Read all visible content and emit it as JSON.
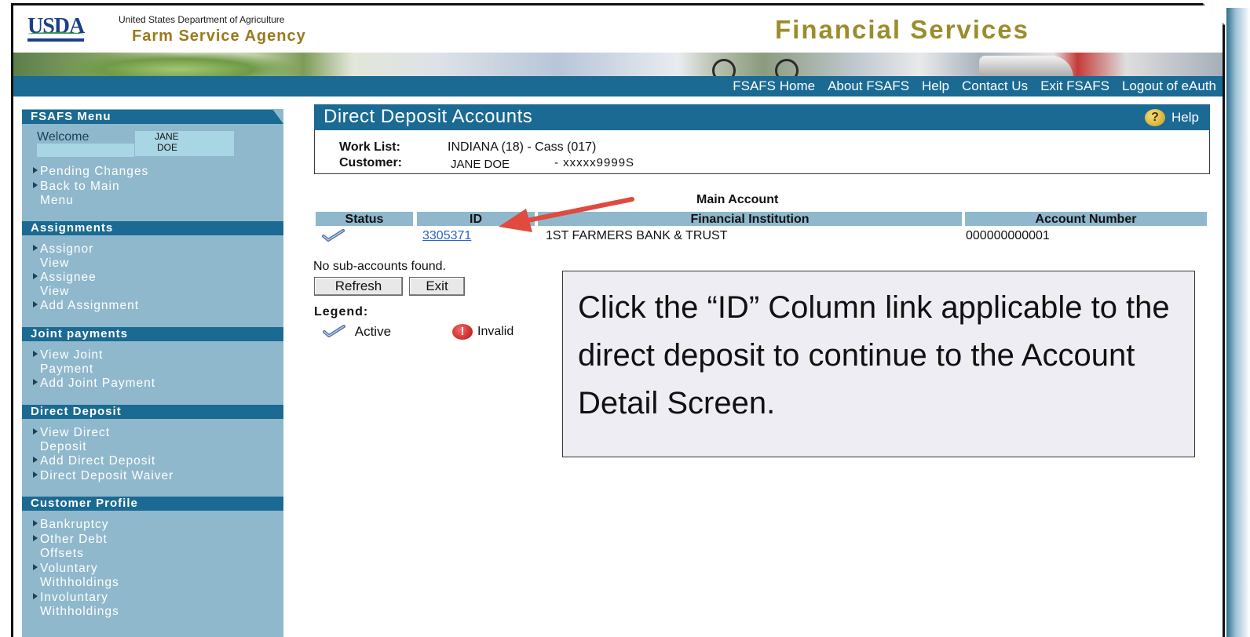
{
  "header": {
    "logo_text": "USDA",
    "department": "United States Department of Agriculture",
    "agency": "Farm Service Agency",
    "app_title": "Financial Services"
  },
  "topnav": {
    "items": [
      "FSAFS Home",
      "About FSAFS",
      "Help",
      "Contact Us",
      "Exit FSAFS",
      "Logout of eAuth"
    ]
  },
  "sidebar": {
    "menu_title": "FSAFS Menu",
    "welcome_label": "Welcome",
    "user_first": "JANE",
    "user_last": "DOE",
    "menu_items": [
      {
        "l1": "Pending Changes",
        "l2": ""
      },
      {
        "l1": "Back to Main",
        "l2": "Menu"
      }
    ],
    "assignments": {
      "title": "Assignments",
      "items": [
        {
          "l1": "Assignor",
          "l2": "View"
        },
        {
          "l1": "Assignee",
          "l2": "View"
        },
        {
          "l1": "Add Assignment",
          "l2": ""
        }
      ]
    },
    "joint_payments": {
      "title": "Joint payments",
      "items": [
        {
          "l1": "View Joint",
          "l2": "Payment"
        },
        {
          "l1": "Add Joint Payment",
          "l2": ""
        }
      ]
    },
    "direct_deposit": {
      "title": "Direct Deposit",
      "items": [
        {
          "l1": "View Direct",
          "l2": "Deposit"
        },
        {
          "l1": "Add Direct Deposit",
          "l2": ""
        },
        {
          "l1": "Direct Deposit Waiver",
          "l2": ""
        }
      ]
    },
    "customer_profile": {
      "title": "Customer Profile",
      "items": [
        {
          "l1": "Bankruptcy",
          "l2": ""
        },
        {
          "l1": "Other Debt",
          "l2": "Offsets"
        },
        {
          "l1": "Voluntary",
          "l2": "Withholdings"
        },
        {
          "l1": "Involuntary",
          "l2": "Withholdings"
        }
      ]
    }
  },
  "main": {
    "title": "Direct Deposit Accounts",
    "help_label": "Help",
    "help_icon": "question-icon",
    "work_list_label": "Work List:",
    "work_list_value": "INDIANA (18) - Cass (017)",
    "customer_label": "Customer:",
    "customer_name": "JANE DOE",
    "customer_id": "- xxxxx9999S",
    "table_caption": "Main Account",
    "columns": [
      "Status",
      "ID",
      "Financial Institution",
      "Account Number"
    ],
    "rows": [
      {
        "status_icon": "check-icon",
        "id": "3305371",
        "institution": "1ST FARMERS BANK & TRUST",
        "account_number": "000000000001"
      }
    ],
    "no_sub_text": "No sub-accounts found.",
    "refresh_label": "Refresh",
    "exit_label": "Exit",
    "legend_title": "Legend:",
    "legend_active": "Active",
    "legend_invalid": "Invalid"
  },
  "callout": {
    "text": "Click the “ID” Column link applicable to the direct deposit to continue to the Account Detail Screen."
  },
  "colors": {
    "nav_blue": "#1a6a93",
    "sidebar_bg": "#8fb8cc",
    "title_gold": "#9b8d2c",
    "arrow_red": "#e04a3f"
  }
}
